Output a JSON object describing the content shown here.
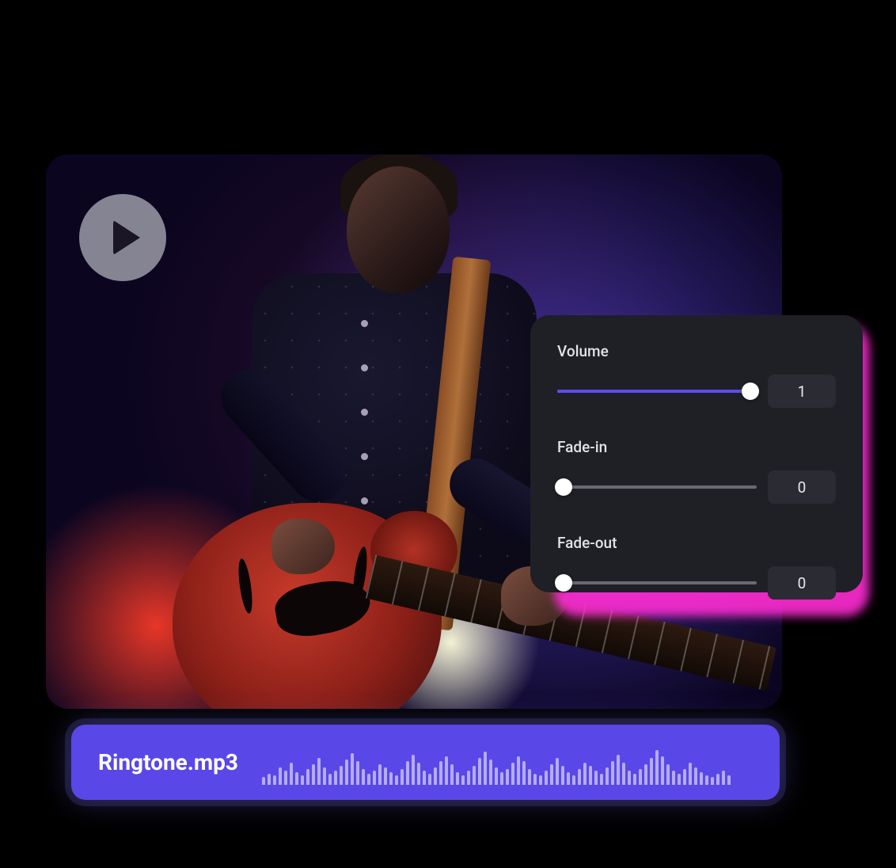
{
  "media": {
    "play_icon": "play",
    "description": "Guitarist performing on stage"
  },
  "controls": {
    "volume": {
      "label": "Volume",
      "value": "1",
      "fill_pct": 97,
      "thumb_pct": 97
    },
    "fade_in": {
      "label": "Fade-in",
      "value": "0",
      "fill_pct": 0,
      "thumb_pct": 3
    },
    "fade_out": {
      "label": "Fade-out",
      "value": "0",
      "fill_pct": 0,
      "thumb_pct": 3
    }
  },
  "audio_chip": {
    "filename": "Ringtone.mp3"
  },
  "colors": {
    "accent": "#5947e8",
    "slider_fill": "#5b4cff",
    "panel_bg": "#1f1f26",
    "glow": "#ff2dd4"
  }
}
